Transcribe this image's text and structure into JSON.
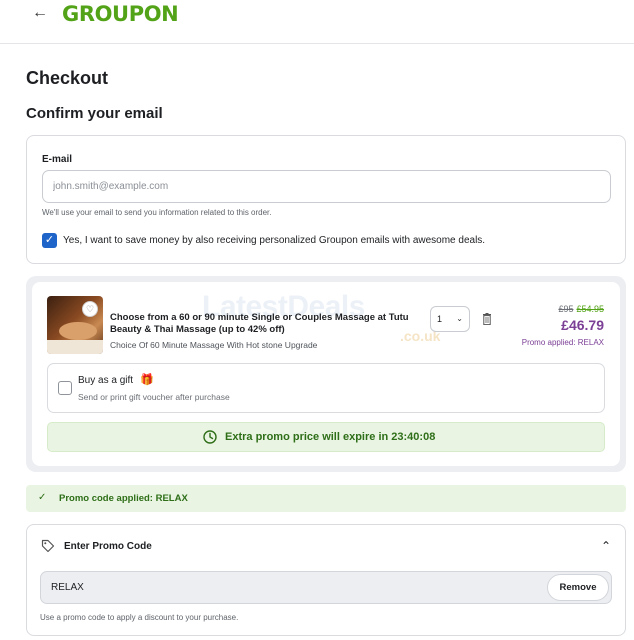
{
  "header": {
    "back_icon": "arrow-left-icon",
    "logo_text": "GROUPON"
  },
  "page": {
    "title": "Checkout",
    "section_title": "Confirm your email"
  },
  "email": {
    "label": "E-mail",
    "value": "",
    "placeholder": "john.smith@example.com",
    "hint": "We'll use your email to send you information related to this order.",
    "consent_checked": true,
    "consent_text": "Yes, I want to save money by also receiving personalized Groupon emails with awesome deals."
  },
  "deal": {
    "title": "Choose from a 60 or 90 minute Single or Couples Massage at Tutu Beauty & Thai Massage (up to 42% off)",
    "option": "Choice Of 60 Minute Massage With Hot stone Upgrade",
    "quantity": "1",
    "price_original": "£95",
    "price_strike": "£54.95",
    "price_current": "£46.79",
    "promo_applied": "Promo applied: RELAX",
    "watermark": "LatestDeals",
    "watermark_sub": ".co.uk",
    "gift_title": "Buy as a gift",
    "gift_checked": false,
    "gift_subtitle": "Send or print gift voucher after purchase",
    "timer_text": "Extra promo price will expire in 23:40:08"
  },
  "promo_banner": {
    "text": "Promo code applied: RELAX"
  },
  "promo": {
    "heading": "Enter Promo Code",
    "value": "RELAX",
    "remove_label": "Remove",
    "hint": "Use a promo code to apply a discount to your purchase."
  },
  "colors": {
    "brand_green": "#53a318",
    "checkbox_blue": "#1f64c9",
    "price_purple": "#7b3f95",
    "promo_green_bg": "#e9f5e2"
  }
}
